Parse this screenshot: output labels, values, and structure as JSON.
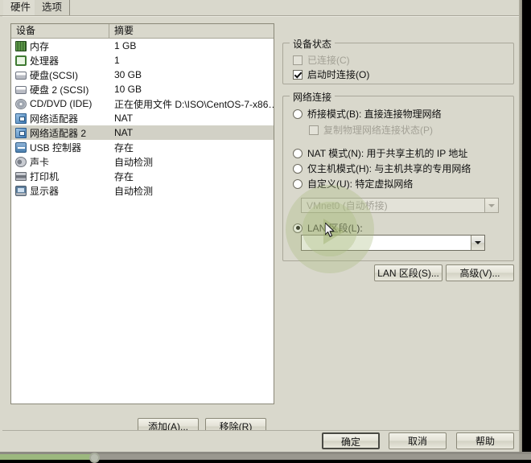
{
  "window": {
    "tabs": [
      {
        "label": "硬件",
        "active": true
      },
      {
        "label": "选项",
        "active": false
      }
    ]
  },
  "device_list": {
    "columns": [
      "设备",
      "摘要"
    ],
    "rows": [
      {
        "icon": "memory-icon",
        "name": "内存",
        "summary": "1 GB",
        "selected": false
      },
      {
        "icon": "processor-icon",
        "name": "处理器",
        "summary": "1",
        "selected": false
      },
      {
        "icon": "harddisk-icon",
        "name": "硬盘(SCSI)",
        "summary": "30 GB",
        "selected": false
      },
      {
        "icon": "harddisk-icon",
        "name": "硬盘 2 (SCSI)",
        "summary": "10 GB",
        "selected": false
      },
      {
        "icon": "cddvd-icon",
        "name": "CD/DVD (IDE)",
        "summary": "正在使用文件 D:\\ISO\\CentOS-7-x86…",
        "selected": false
      },
      {
        "icon": "network-adapter-icon",
        "name": "网络适配器",
        "summary": "NAT",
        "selected": false
      },
      {
        "icon": "network-adapter-icon",
        "name": "网络适配器 2",
        "summary": "NAT",
        "selected": true
      },
      {
        "icon": "usb-controller-icon",
        "name": "USB 控制器",
        "summary": "存在",
        "selected": false
      },
      {
        "icon": "sound-card-icon",
        "name": "声卡",
        "summary": "自动检测",
        "selected": false
      },
      {
        "icon": "printer-icon",
        "name": "打印机",
        "summary": "存在",
        "selected": false
      },
      {
        "icon": "display-icon",
        "name": "显示器",
        "summary": "自动检测",
        "selected": false
      }
    ],
    "add_button": "添加(A)...",
    "remove_button": "移除(R)"
  },
  "device_status": {
    "title": "设备状态",
    "connected": {
      "label": "已连接(C)",
      "checked": false,
      "disabled": true
    },
    "connect_at_power_on": {
      "label": "启动时连接(O)",
      "checked": true,
      "disabled": false
    }
  },
  "network_connection": {
    "title": "网络连接",
    "options": [
      {
        "label": "桥接模式(B): 直接连接物理网络",
        "selected": false
      },
      {
        "label": "NAT 模式(N): 用于共享主机的 IP 地址",
        "selected": false
      },
      {
        "label": "仅主机模式(H): 与主机共享的专用网络",
        "selected": false
      },
      {
        "label": "自定义(U): 特定虚拟网络",
        "selected": false
      },
      {
        "label": "LAN 区段(L):",
        "selected": true
      }
    ],
    "replicate_physical_state": {
      "label": "复制物理网络连接状态(P)",
      "checked": false,
      "disabled": true
    },
    "custom_network_combo": {
      "value": "VMnet0 (自动桥接)",
      "disabled": true
    },
    "lan_segment_combo": {
      "value": "",
      "disabled": false
    },
    "lan_segment_button": "LAN 区段(S)...",
    "advanced_button": "高级(V)..."
  },
  "footer": {
    "ok": "确定",
    "cancel": "取消",
    "help": "帮助"
  },
  "colors": {
    "dialog_bg": "#d9d8cc",
    "list_bg": "#ffffff",
    "selection": "#d2d1c6",
    "ripple_green": "#a8ba7c",
    "progress_green": "#9cb87e"
  }
}
